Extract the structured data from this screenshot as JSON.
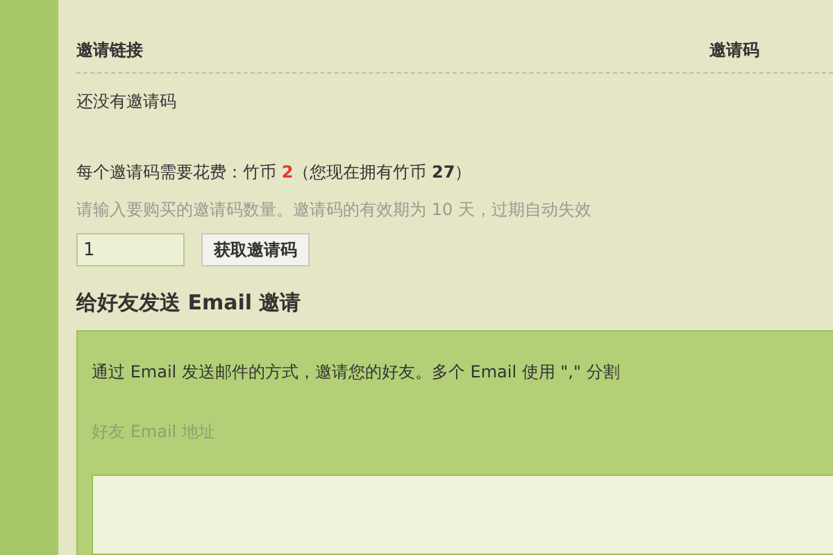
{
  "invite_table": {
    "columns": [
      "邀请链接",
      "邀请码"
    ],
    "empty_text": "还没有邀请码"
  },
  "purchase": {
    "cost_before": "每个邀请码需要花费：竹币 ",
    "cost_amount": "2",
    "cost_after": "（您现在拥有竹币 **27**）",
    "hint": "请输入要购买的邀请码数量。邀请码的有效期为 10 天，过期自动失效",
    "quantity": "1",
    "button": "获取邀请码"
  },
  "email_invite": {
    "heading": "给好友发送 Email 邀请",
    "description": "通过 Email 发送邮件的方式，邀请您的好友。多个 Email 使用 \",\" 分割",
    "field_label": "好友 Email 地址"
  }
}
